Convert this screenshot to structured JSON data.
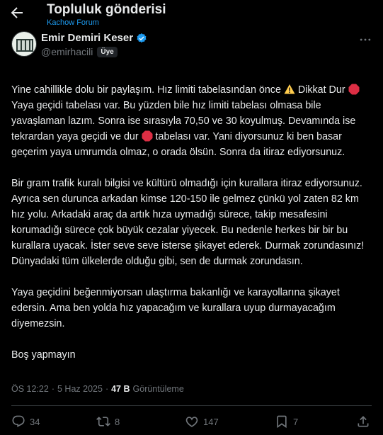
{
  "header": {
    "title": "Topluluk gönderisi",
    "subtitle": "Kachow Forum"
  },
  "author": {
    "name": "Emir Demiri Keser",
    "handle": "@emirhacili",
    "badge": "Üye",
    "verified": true
  },
  "post": {
    "p1a": "Yine cahillikle dolu bir paylaşım. Hız limiti tabelasından önce ",
    "p1b": " Dikkat Dur ",
    "p1c": " Yaya geçidi tabelası var. Bu yüzden bile hız limiti tabelası olmasa bile yavaşlaman lazım. Sonra ise sırasıyla 70,50 ve 30 koyulmuş. Devamında ise tekrardan yaya geçidi ve dur ",
    "p1d": " tabelası var. Yani diyorsunuz ki ben basar geçerim yaya umrumda olmaz, o orada ölsün. Sonra da itiraz ediyorsunuz.",
    "p2": "Bir gram trafik kuralı bilgisi ve kültürü olmadığı için kurallara itiraz ediyorsunuz. Ayrıca sen durunca arkadan kimse 120-150 ile gelmez çünkü yol zaten 82 km hız yolu. Arkadaki araç da artık hıza uymadığı sürece, takip mesafesini korumadığı sürece çok büyük cezalar yiyecek. Bu nedenle herkes bir bir bu kurallara uyacak. İster seve seve isterse şikayet ederek. Durmak zorundasınız! Dünyadaki tüm ülkelerde olduğu gibi, sen de durmak zorundasın.",
    "p3": "Yaya geçidini beğenmiyorsan ulaştırma bakanlığı ve karayollarına şikayet edersin. Ama ben yolda hız yapacağım ve kurallara uyup durmayacağım diyemezsin.",
    "p4": "Boş yapmayın"
  },
  "meta": {
    "time": "ÖS 12:22",
    "sep": "·",
    "date": "5 Haz 2025",
    "views_count": "47 B",
    "views_label": "Görüntüleme"
  },
  "actions": {
    "replies": "34",
    "reposts": "8",
    "likes": "147",
    "bookmarks": "7"
  },
  "colors": {
    "accent": "#1d9bf0",
    "muted": "#71767b",
    "text": "#e7e9ea",
    "background": "#000000"
  },
  "icons": [
    "back-arrow-icon",
    "verified-icon",
    "more-icon",
    "warning-icon",
    "stop-sign-icon",
    "reply-icon",
    "repost-icon",
    "like-icon",
    "bookmark-icon",
    "share-icon"
  ]
}
